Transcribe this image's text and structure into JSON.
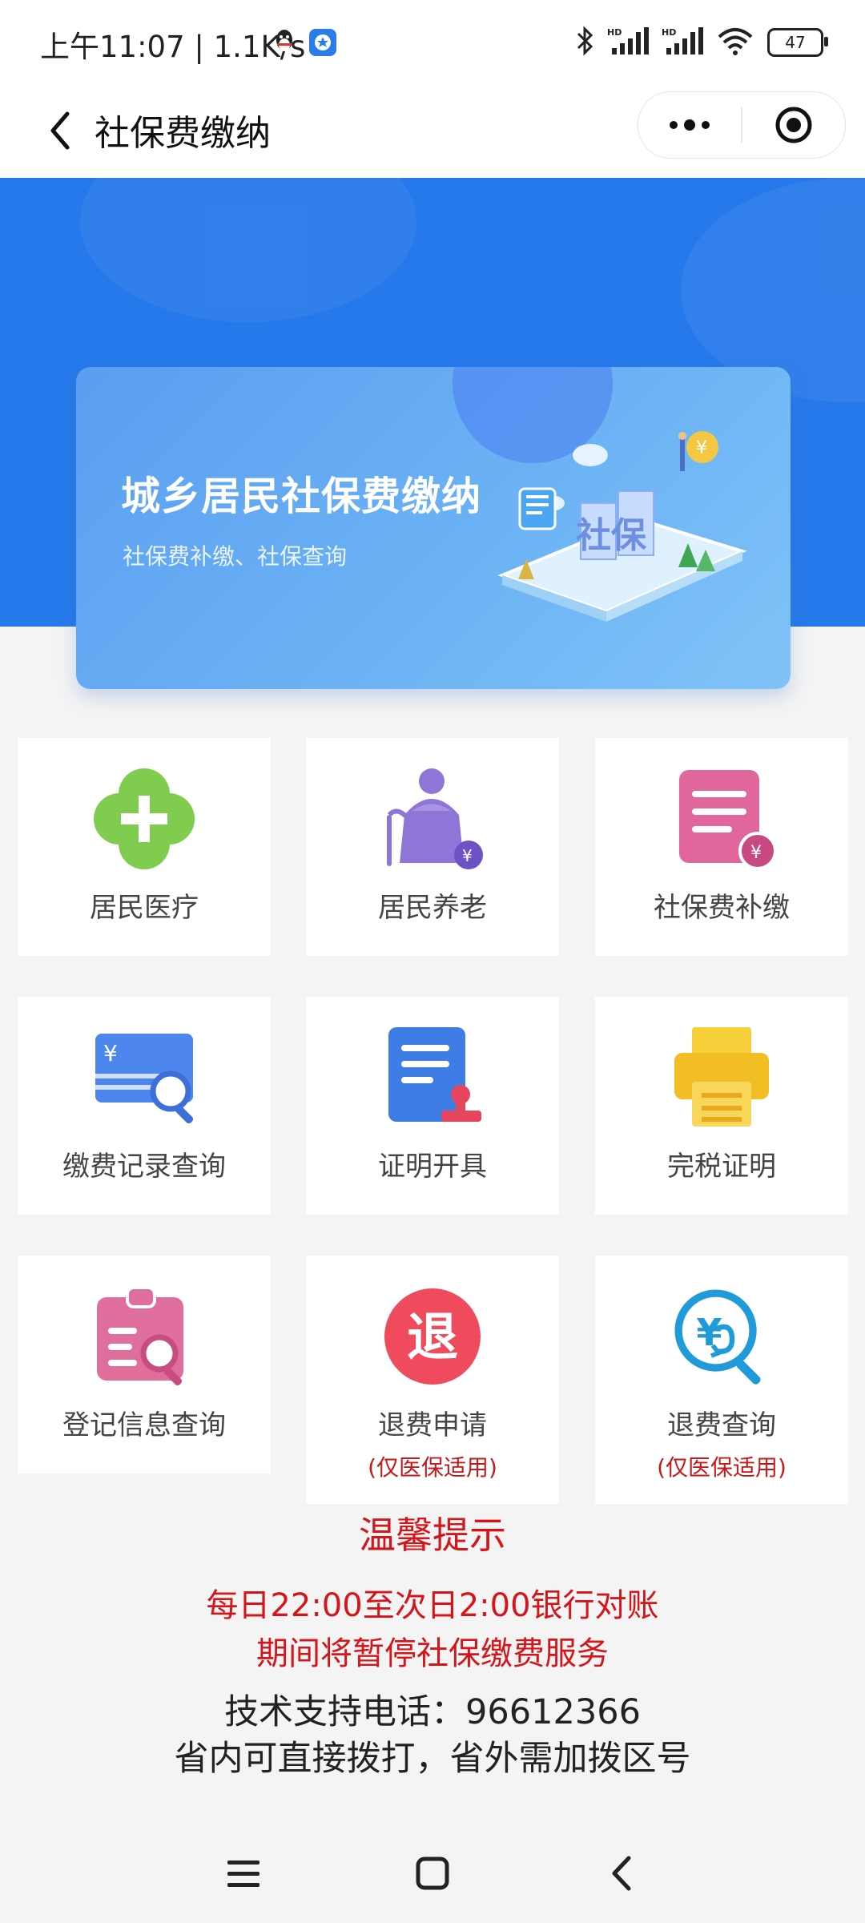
{
  "status_bar": {
    "time_text": "上午11:07 | 1.1K/s",
    "battery": "47"
  },
  "nav": {
    "title": "社保费缴纳"
  },
  "banner": {
    "title": "城乡居民社保费缴纳",
    "subtitle": "社保费补缴、社保查询",
    "art_text": "社保"
  },
  "services": [
    {
      "label": "居民医疗",
      "icon": "medical-cross-icon"
    },
    {
      "label": "居民养老",
      "icon": "elderly-person-icon"
    },
    {
      "label": "社保费补缴",
      "icon": "document-yuan-icon"
    },
    {
      "label": "缴费记录查询",
      "icon": "card-search-icon"
    },
    {
      "label": "证明开具",
      "icon": "document-stamp-icon"
    },
    {
      "label": "完税证明",
      "icon": "printer-icon"
    },
    {
      "label": "登记信息查询",
      "icon": "clipboard-search-icon"
    },
    {
      "label": "退费申请",
      "note": "(仅医保适用)",
      "icon": "refund-icon",
      "glyph": "退"
    },
    {
      "label": "退费查询",
      "note": "(仅医保适用)",
      "icon": "refund-search-icon"
    }
  ],
  "notice": {
    "title": "温馨提示",
    "line1": "每日22:00至次日2:00银行对账",
    "line2": "期间将暂停社保缴费服务",
    "line3": "技术支持电话：96612366",
    "line4": "省内可直接拨打，省外需加拨区号"
  },
  "colors": {
    "hero_blue": "#2679ea",
    "notice_red": "#d4161b"
  }
}
